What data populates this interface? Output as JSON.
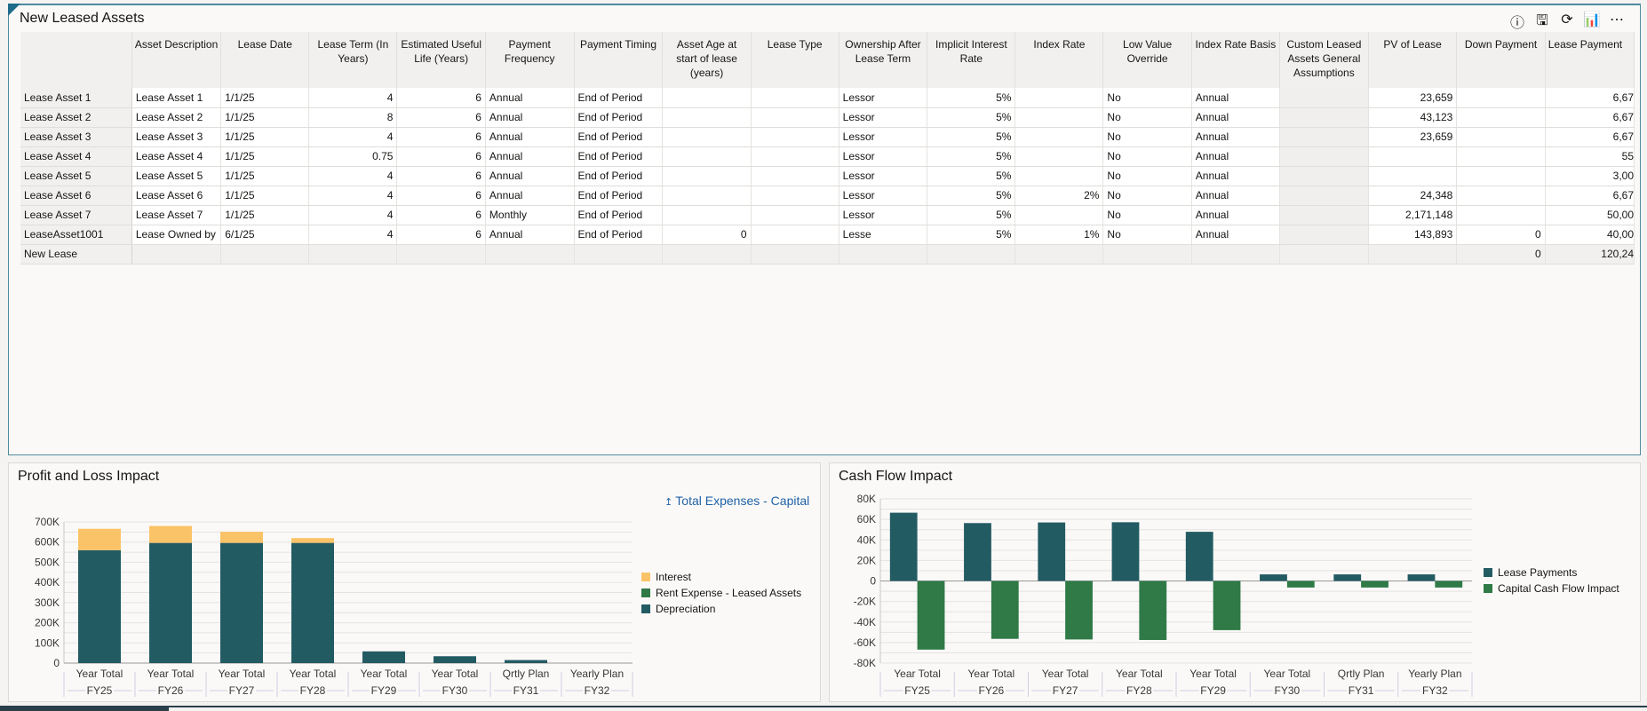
{
  "leased_assets": {
    "title": "New Leased Assets",
    "toolbar": [
      {
        "name": "info-icon",
        "glyph": "ⓘ"
      },
      {
        "name": "save-icon",
        "glyph": "🖫"
      },
      {
        "name": "refresh-icon",
        "glyph": "⟳"
      },
      {
        "name": "chart-icon",
        "glyph": "📊"
      },
      {
        "name": "more-icon",
        "glyph": "⋯"
      }
    ],
    "columns": [
      "Asset Description",
      "Lease Date",
      "Lease Term (In Years)",
      "Estimated Useful Life (Years)",
      "Payment Frequency",
      "Payment Timing",
      "Asset Age at start of lease (years)",
      "Lease Type",
      "Ownership After Lease Term",
      "Implicit Interest Rate",
      "Index Rate",
      "Low Value Override",
      "Index Rate Basis",
      "Custom Leased Assets General Assumptions",
      "PV of Lease",
      "Down Payment",
      "Lease Payment"
    ],
    "rows": [
      {
        "header": "Lease Asset 1",
        "cells": [
          "Lease Asset 1",
          "1/1/25",
          "4",
          "6",
          "Annual",
          "End of Period",
          "",
          "",
          "Lessor",
          "5%",
          "",
          "No",
          "Annual",
          "",
          "23,659",
          "",
          "6,67"
        ]
      },
      {
        "header": "Lease Asset 2",
        "cells": [
          "Lease Asset 2",
          "1/1/25",
          "8",
          "6",
          "Annual",
          "End of Period",
          "",
          "",
          "Lessor",
          "5%",
          "",
          "No",
          "Annual",
          "",
          "43,123",
          "",
          "6,67"
        ]
      },
      {
        "header": "Lease Asset 3",
        "cells": [
          "Lease Asset 3",
          "1/1/25",
          "4",
          "6",
          "Annual",
          "End of Period",
          "",
          "",
          "Lessor",
          "5%",
          "",
          "No",
          "Annual",
          "",
          "23,659",
          "",
          "6,67"
        ]
      },
      {
        "header": "Lease Asset 4",
        "cells": [
          "Lease Asset 4",
          "1/1/25",
          "0.75",
          "6",
          "Annual",
          "End of Period",
          "",
          "",
          "Lessor",
          "5%",
          "",
          "No",
          "Annual",
          "",
          "",
          "",
          "55"
        ]
      },
      {
        "header": "Lease Asset 5",
        "cells": [
          "Lease Asset 5",
          "1/1/25",
          "4",
          "6",
          "Annual",
          "End of Period",
          "",
          "",
          "Lessor",
          "5%",
          "",
          "No",
          "Annual",
          "",
          "",
          "",
          "3,00"
        ]
      },
      {
        "header": "Lease Asset 6",
        "cells": [
          "Lease Asset 6",
          "1/1/25",
          "4",
          "6",
          "Annual",
          "End of Period",
          "",
          "",
          "Lessor",
          "5%",
          "2%",
          "No",
          "Annual",
          "",
          "24,348",
          "",
          "6,67"
        ]
      },
      {
        "header": "Lease Asset 7",
        "cells": [
          "Lease Asset 7",
          "1/1/25",
          "4",
          "6",
          "Monthly",
          "End of Period",
          "",
          "",
          "Lessor",
          "5%",
          "",
          "No",
          "Annual",
          "",
          "2,171,148",
          "",
          "50,00"
        ]
      },
      {
        "header": "LeaseAsset1001",
        "cells": [
          "Lease Owned by",
          "6/1/25",
          "4",
          "6",
          "Annual",
          "End of Period",
          "0",
          "",
          "Lesse",
          "5%",
          "1%",
          "No",
          "Annual",
          "",
          "143,893",
          "0",
          "40,00"
        ]
      },
      {
        "header": "New Lease",
        "cells": [
          "",
          "",
          "",
          "",
          "",
          "",
          "",
          "",
          "",
          "",
          "",
          "",
          "",
          "",
          "",
          "0",
          "120,24"
        ]
      }
    ]
  },
  "pnl": {
    "title": "Profit and Loss Impact",
    "link": "Total Expenses - Capital",
    "link_icon": "drill-up-icon",
    "chart_data": {
      "type": "bar",
      "stacked": true,
      "categories": [
        [
          "Year Total",
          "FY25"
        ],
        [
          "Year Total",
          "FY26"
        ],
        [
          "Year Total",
          "FY27"
        ],
        [
          "Year Total",
          "FY28"
        ],
        [
          "Year Total",
          "FY29"
        ],
        [
          "Year Total",
          "FY30"
        ],
        [
          "Qrtly Plan",
          "FY31"
        ],
        [
          "Yearly Plan",
          "FY32"
        ]
      ],
      "series": [
        {
          "name": "Depreciation",
          "color": "#235b63",
          "values": [
            560000,
            596000,
            596000,
            596000,
            58000,
            34000,
            15000,
            0
          ]
        },
        {
          "name": "Rent Expense - Leased Assets",
          "color": "#2f7a47",
          "values": [
            0,
            0,
            0,
            0,
            0,
            0,
            0,
            0
          ]
        },
        {
          "name": "Interest",
          "color": "#fbc367",
          "values": [
            106000,
            84000,
            55000,
            24000,
            0,
            0,
            0,
            0
          ]
        }
      ],
      "legend_order": [
        "Interest",
        "Rent Expense - Leased Assets",
        "Depreciation"
      ],
      "ylim": [
        0,
        700000
      ],
      "yticks": [
        "0",
        "100K",
        "200K",
        "300K",
        "400K",
        "500K",
        "600K",
        "700K"
      ],
      "grid": true,
      "legend": "right"
    }
  },
  "cashflow": {
    "title": "Cash Flow Impact",
    "chart_data": {
      "type": "bar",
      "categories": [
        [
          "Year Total",
          "FY25"
        ],
        [
          "Year Total",
          "FY26"
        ],
        [
          "Year Total",
          "FY27"
        ],
        [
          "Year Total",
          "FY28"
        ],
        [
          "Year Total",
          "FY29"
        ],
        [
          "Year Total",
          "FY30"
        ],
        [
          "Qrtly Plan",
          "FY31"
        ],
        [
          "Yearly Plan",
          "FY32"
        ]
      ],
      "series": [
        {
          "name": "Lease Payments",
          "color": "#235b63",
          "values": [
            66500,
            56400,
            57000,
            57200,
            47900,
            6400,
            6400,
            6400
          ]
        },
        {
          "name": "Capital Cash Flow Impact",
          "color": "#2f7a47",
          "values": [
            -66900,
            -56400,
            -57000,
            -57500,
            -47900,
            -6400,
            -6400,
            -6400
          ]
        }
      ],
      "ylim": [
        -80000,
        80000
      ],
      "yticks": [
        "-80K",
        "-60K",
        "-40K",
        "-20K",
        "0",
        "20K",
        "40K",
        "60K",
        "80K"
      ],
      "grid": true,
      "legend": "right"
    }
  }
}
